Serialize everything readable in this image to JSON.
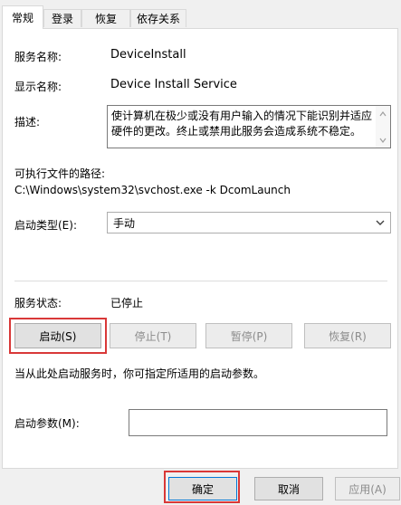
{
  "tabs": [
    {
      "label": "常规",
      "active": true
    },
    {
      "label": "登录",
      "active": false
    },
    {
      "label": "恢复",
      "active": false
    },
    {
      "label": "依存关系",
      "active": false
    }
  ],
  "general": {
    "service_name_label": "服务名称:",
    "service_name": "DeviceInstall",
    "display_name_label": "显示名称:",
    "display_name": "Device Install Service",
    "description_label": "描述:",
    "description": "使计算机在极少或没有用户输入的情况下能识别并适应硬件的更改。终止或禁用此服务会造成系统不稳定。",
    "exe_path_label": "可执行文件的路径:",
    "exe_path": "C:\\Windows\\system32\\svchost.exe -k DcomLaunch",
    "startup_type_label": "启动类型(E):",
    "startup_type_value": "手动",
    "service_status_label": "服务状态:",
    "service_status": "已停止",
    "start_button": "启动(S)",
    "stop_button": "停止(T)",
    "pause_button": "暂停(P)",
    "resume_button": "恢复(R)",
    "hint": "当从此处启动服务时，你可指定所适用的启动参数。",
    "start_params_label": "启动参数(M):",
    "start_params_value": ""
  },
  "footer": {
    "ok_button": "确定",
    "cancel_button": "取消",
    "apply_button": "应用(A)"
  },
  "highlight_color": "#d93838",
  "icons": [
    "chevron-up-icon",
    "chevron-down-icon",
    "dropdown-arrow-icon"
  ]
}
